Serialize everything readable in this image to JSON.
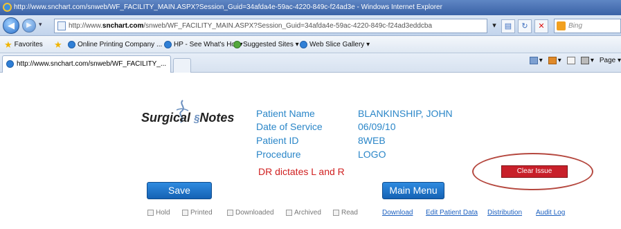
{
  "window": {
    "title": "http://www.snchart.com/snweb/WF_FACILITY_MAIN.ASPX?Session_Guid=34afda4e-59ac-4220-849c-f24ad3e - Windows Internet Explorer"
  },
  "address_bar": {
    "url_prefix": "http://www.",
    "url_domain": "snchart.com",
    "url_rest": "/snweb/WF_FACILITY_MAIN.ASPX?Session_Guid=34afda4e-59ac-4220-849c-f24ad3eddcba",
    "search_placeholder": "Bing"
  },
  "favorites_bar": {
    "favorites_label": "Favorites",
    "items": [
      {
        "label": "Online Printing Company ..."
      },
      {
        "label": "HP - See What's Hot ▾"
      },
      {
        "label": "Suggested Sites ▾"
      },
      {
        "label": "Web Slice Gallery ▾"
      }
    ]
  },
  "tabs": [
    {
      "label": "http://www.snchart.com/snweb/WF_FACILITY_..."
    }
  ],
  "command_bar": {
    "page_label": "Page ▾"
  },
  "page": {
    "logo_text_a": "Surgical",
    "logo_text_b": "Notes",
    "fields": [
      {
        "label": "Patient Name",
        "value": "BLANKINSHIP, JOHN"
      },
      {
        "label": "Date of Service",
        "value": "06/09/10"
      },
      {
        "label": "Patient ID",
        "value": "8WEB"
      },
      {
        "label": "Procedure",
        "value": "LOGO"
      }
    ],
    "dictates_note": "DR dictates L and R",
    "clear_issue_label": "Clear Issue",
    "save_label": "Save",
    "main_menu_label": "Main Menu",
    "checkboxes": [
      {
        "label": "Hold"
      },
      {
        "label": "Printed"
      },
      {
        "label": "Downloaded"
      },
      {
        "label": "Archived"
      },
      {
        "label": "Read"
      }
    ],
    "links": [
      {
        "label": "Download"
      },
      {
        "label": "Edit Patient Data"
      },
      {
        "label": "Distribution"
      },
      {
        "label": "Audit Log"
      }
    ]
  },
  "colors": {
    "field_text": "#2a86c8",
    "alert_text": "#d02020",
    "clear_button": "#c8202a",
    "primary_button": "#1f75cc",
    "annotation_circle": "#b5483f"
  }
}
